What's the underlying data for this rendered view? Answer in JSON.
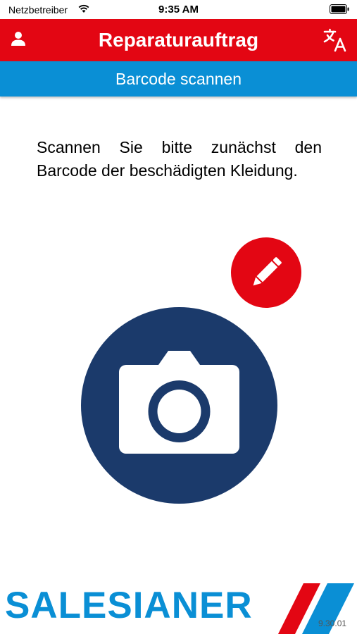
{
  "status_bar": {
    "carrier": "Netzbetreiber",
    "time": "9:35 AM"
  },
  "header": {
    "title": "Reparaturauftrag",
    "left_icon": "user-icon",
    "right_icon": "translate-icon"
  },
  "subheader": {
    "title": "Barcode scannen"
  },
  "main": {
    "instruction": "Scannen Sie bitte zunächst den Barcode der beschädigten Kleidung.",
    "edit_icon": "pencil-icon",
    "scan_icon": "camera-icon"
  },
  "footer": {
    "brand": "SALESIANER",
    "version": "9.30.01"
  },
  "colors": {
    "header_red": "#e30613",
    "subheader_blue": "#0a8fd5",
    "camera_navy": "#1b3a6b",
    "brand_blue": "#0a8fd5"
  }
}
